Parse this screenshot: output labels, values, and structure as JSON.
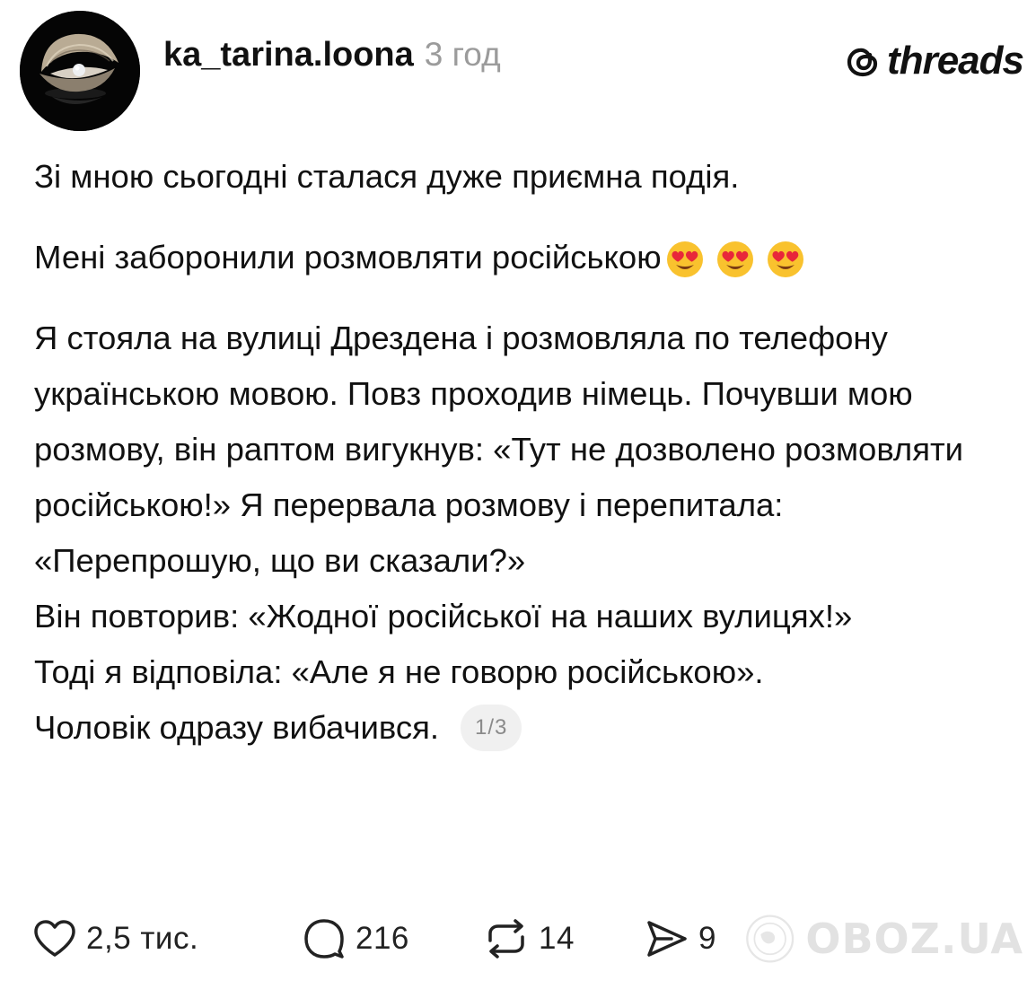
{
  "header": {
    "username": "ka_tarina.loona",
    "time_ago": "3 год",
    "brand": "threads"
  },
  "post": {
    "lines": {
      "p1": "Зі мною сьогодні сталася дуже приємна подія.",
      "p2": "Мені заборонили розмовляти російською",
      "p3": "Я стояла на вулиці Дрездена і розмовляла по телефону українською мовою. Повз проходив німець. Почувши мою розмову, він раптом вигукнув: «Тут не дозволено розмовляти російською!» Я перервала розмову і перепитала: «Перепрошую, що ви сказали?»",
      "p4": "Він повторив: «Жодної російської на наших вулицях!»",
      "p5": "Тоді я відповіла: «Але я не говорю російською».",
      "p6": "Чоловік одразу вибачився."
    },
    "emoji": [
      "smiling-face-with-heart-eyes",
      "smiling-face-with-heart-eyes",
      "smiling-face-with-heart-eyes"
    ],
    "page_indicator": "1/3"
  },
  "actions": {
    "likes": "2,5 тис.",
    "comments": "216",
    "reposts": "14",
    "shares": "9"
  },
  "watermark": {
    "text": "OBOZ.UA"
  },
  "colors": {
    "text": "#111111",
    "muted": "#9b9b9b",
    "badge_bg": "#f0f0f0"
  }
}
